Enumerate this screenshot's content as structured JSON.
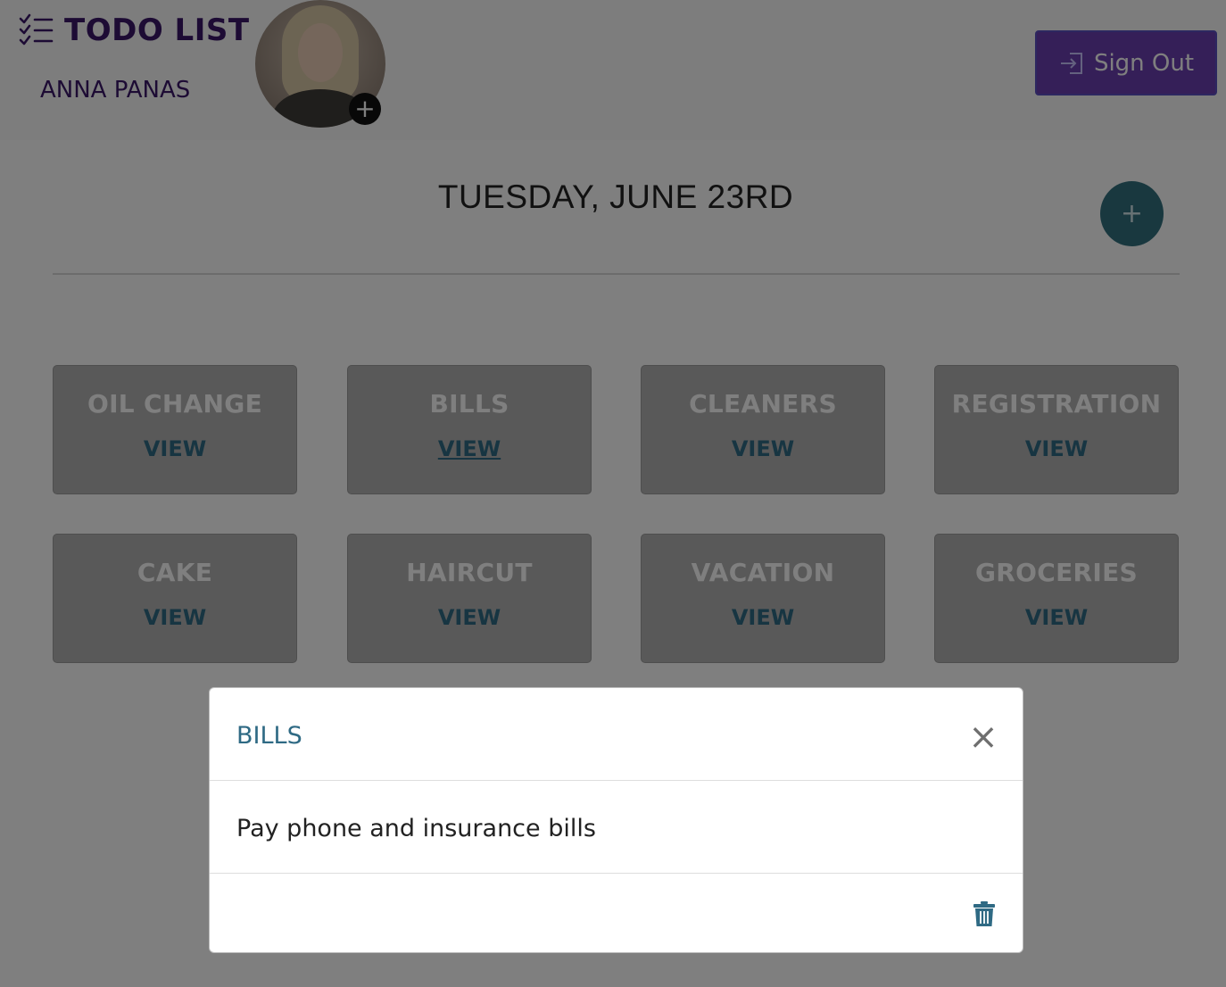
{
  "header": {
    "app_title": "TODO LIST",
    "user_name": "ANNA PANAS",
    "avatar_add_label": "+",
    "sign_out_label": "Sign Out",
    "brand_icon": "checklist-icon",
    "sign_out_icon": "sign-in-arrow-icon"
  },
  "main": {
    "date_title": "TUESDAY, JUNE 23RD",
    "add_task_label": "+",
    "cards": [
      {
        "title": "OIL CHANGE",
        "action": "VIEW"
      },
      {
        "title": "BILLS",
        "action": "VIEW"
      },
      {
        "title": "CLEANERS",
        "action": "VIEW"
      },
      {
        "title": "REGISTRATION",
        "action": "VIEW"
      },
      {
        "title": "CAKE",
        "action": "VIEW"
      },
      {
        "title": "HAIRCUT",
        "action": "VIEW"
      },
      {
        "title": "VACATION",
        "action": "VIEW"
      },
      {
        "title": "GROCERIES",
        "action": "VIEW"
      }
    ]
  },
  "modal": {
    "title": "BILLS",
    "close_label": "×",
    "body_text": "Pay phone and insurance bills",
    "delete_icon": "trash-icon"
  },
  "colors": {
    "brand": "#3a1769",
    "accent": "#2f6a84",
    "sign_out_bg": "#6b3fb0",
    "add_button_bg": "#33717f"
  }
}
